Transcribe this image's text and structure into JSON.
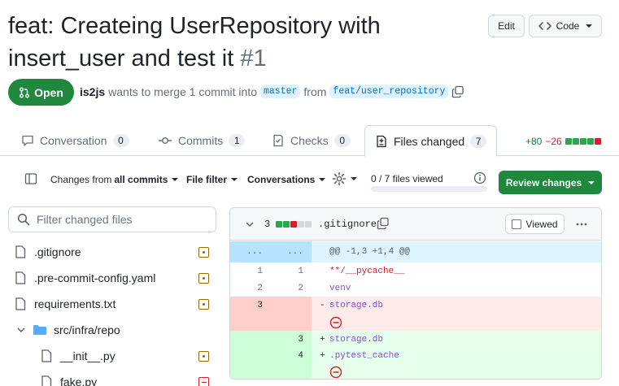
{
  "pr": {
    "title": "feat: Createing UserRepository with insert_user and test it",
    "number": "#1",
    "state": "Open",
    "author": "is2js",
    "merge_text": "wants to merge 1 commit into",
    "base": "master",
    "from_text": "from",
    "head": "feat/user_repository"
  },
  "header_buttons": {
    "edit": "Edit",
    "code": "Code"
  },
  "tabs": [
    {
      "label": "Conversation",
      "count": "0",
      "icon": "comment-icon"
    },
    {
      "label": "Commits",
      "count": "1",
      "icon": "commit-icon"
    },
    {
      "label": "Checks",
      "count": "0",
      "icon": "checklist-icon"
    },
    {
      "label": "Files changed",
      "count": "7",
      "icon": "file-diff-icon"
    }
  ],
  "diffstat": {
    "additions": "+80",
    "deletions": "−26"
  },
  "toolbar": {
    "changes_prefix": "Changes from",
    "changes_value": "all commits",
    "file_filter": "File filter",
    "conversations": "Conversations",
    "files_viewed": "0 / 7 files viewed",
    "files_viewed_fraction": 0,
    "review_changes": "Review changes"
  },
  "file_tree": {
    "filter_placeholder": "Filter changed files",
    "items": [
      {
        "name": ".gitignore",
        "status": "modified"
      },
      {
        "name": ".pre-commit-config.yaml",
        "status": "modified"
      },
      {
        "name": "requirements.txt",
        "status": "modified"
      },
      {
        "name": "src/infra/repo",
        "status": "folder"
      },
      {
        "name": "__init__.py",
        "status": "modified"
      },
      {
        "name": "fake.py",
        "status": "removed"
      }
    ]
  },
  "diff": {
    "changes_count": "3",
    "filename": ".gitignore",
    "viewed_label": "Viewed",
    "hunk_header": "@@ -1,3 +1,4 @@",
    "expand_left": "...",
    "expand_right": "...",
    "lines": [
      {
        "old": "1",
        "new": "1",
        "sign": "",
        "text": "**/__pycache__",
        "type": "context"
      },
      {
        "old": "2",
        "new": "2",
        "sign": "",
        "text": "venv",
        "type": "context"
      },
      {
        "old": "3",
        "new": "",
        "sign": "-",
        "text": "storage.db",
        "type": "del"
      },
      {
        "old": "",
        "new": "3",
        "sign": "+",
        "text": "storage.db",
        "type": "add"
      },
      {
        "old": "",
        "new": "4",
        "sign": "+",
        "text": ".pytest_cache",
        "type": "add"
      }
    ]
  },
  "colors": {
    "green": "#1f883d",
    "del_bg": "#ffebe9",
    "add_bg": "#e6ffec",
    "hunk_bg": "#ddf4ff"
  }
}
